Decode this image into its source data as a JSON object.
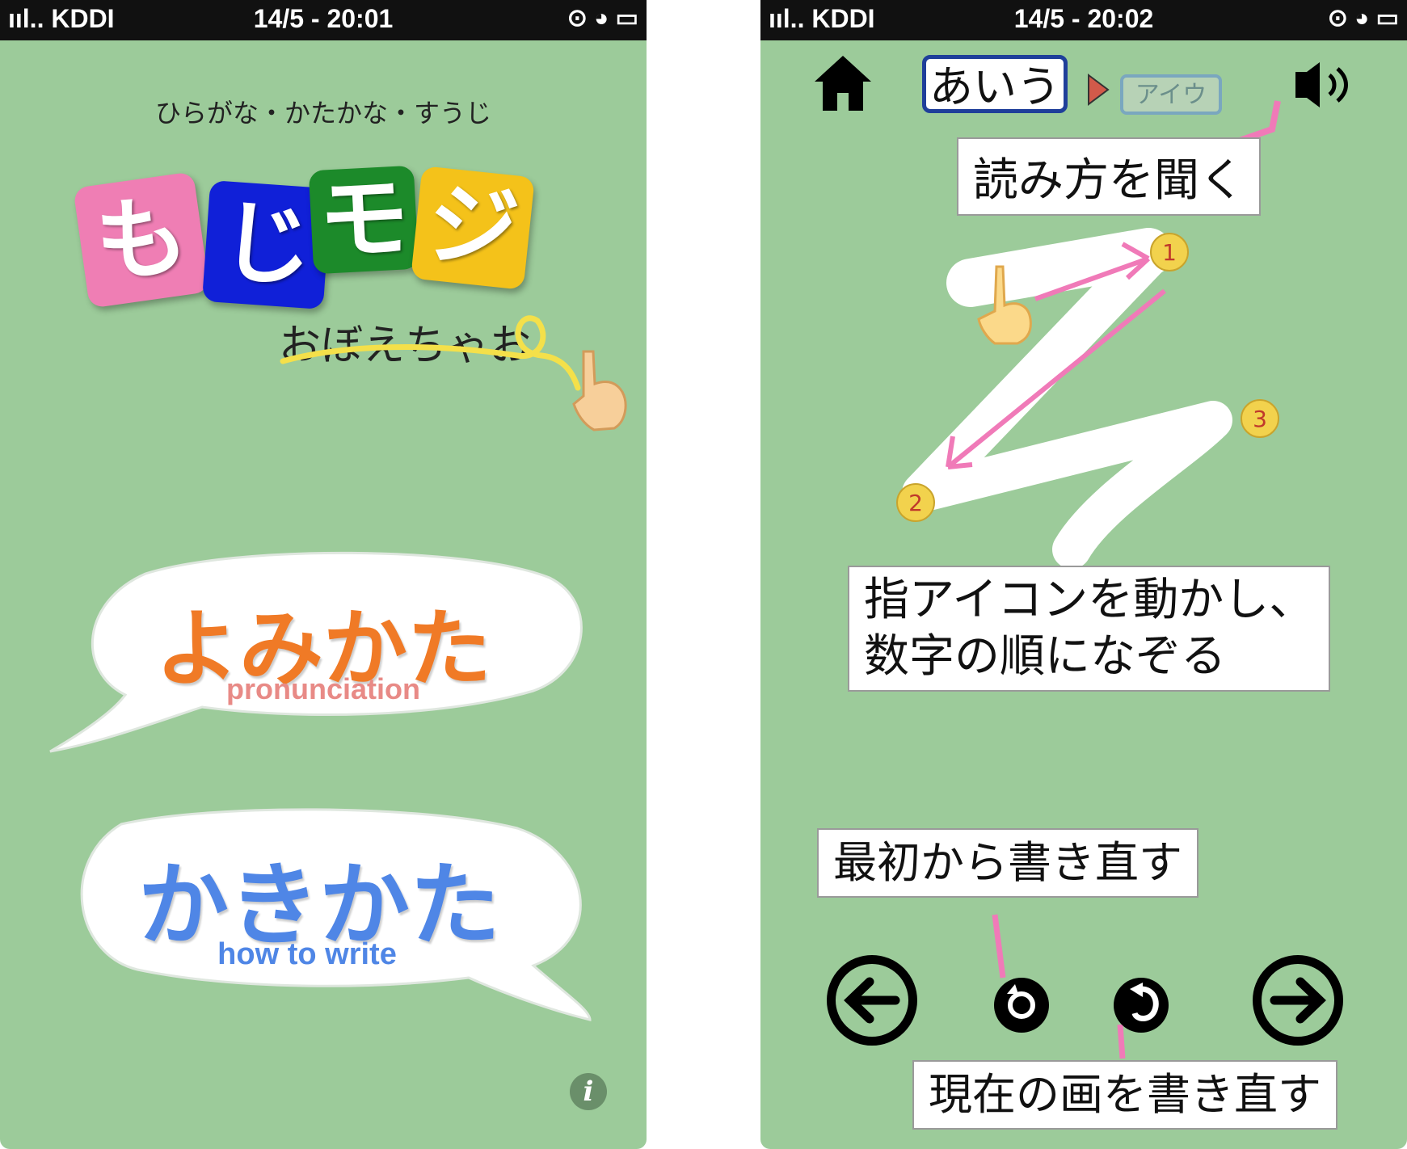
{
  "left_screen": {
    "status": {
      "carrier": "ııl.. KDDI",
      "time": "14/5 - 20:01"
    },
    "subtitle": "ひらがな・かたかな・すうじ",
    "logo": {
      "tiles": [
        {
          "char": "も",
          "color": "#ef7eb4"
        },
        {
          "char": "じ",
          "color": "#1020d8"
        },
        {
          "char": "モ",
          "color": "#1c8a2a"
        },
        {
          "char": "ジ",
          "color": "#f4c21a"
        }
      ],
      "tagline": "おぼえちゃお"
    },
    "yomikata": {
      "title": "よみかた",
      "subtitle": "pronunciation",
      "title_color": "#f07a26",
      "subtitle_color": "#e88a86"
    },
    "kakikata": {
      "title": "かきかた",
      "subtitle": "how to write",
      "title_color": "#4f86e6",
      "subtitle_color": "#4f86e6"
    },
    "info_label": "i"
  },
  "right_screen": {
    "status": {
      "carrier": "ııl.. KDDI",
      "time": "14/5 - 20:02"
    },
    "tabs": {
      "hiragana": "あいう",
      "katakana": "アイウ"
    },
    "stroke_numbers": [
      "1",
      "2",
      "3"
    ],
    "notes": {
      "listen": "読み方を聞く",
      "trace_line1": "指アイコンを動かし、",
      "trace_line2": "数字の順になぞる",
      "restart": "最初から書き直す",
      "redo_current": "現在の画を書き直す"
    },
    "accent_color": "#f07ab8"
  }
}
